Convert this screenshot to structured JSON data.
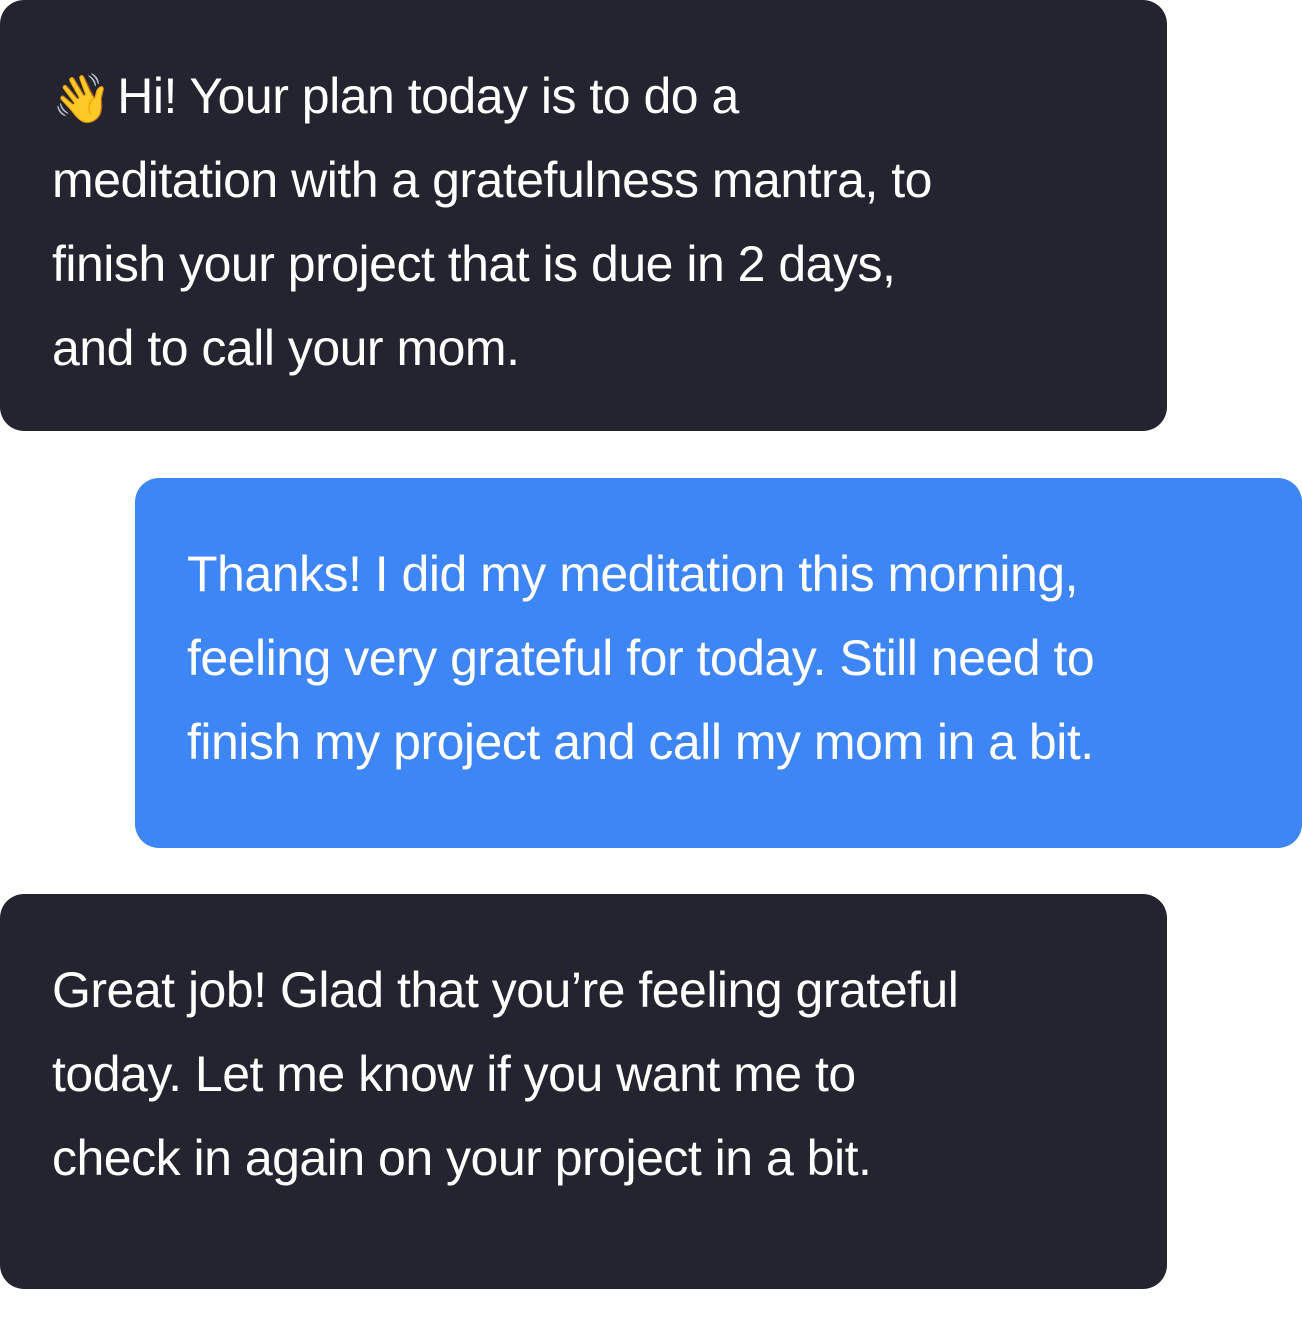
{
  "messages": [
    {
      "sender": "bot",
      "emoji": "👋",
      "text": "Hi! Your plan today is to do a\nmeditation with a gratefulness mantra, to\nfinish your project that is due in 2 days,\nand to call your mom."
    },
    {
      "sender": "user",
      "text": "Thanks! I did my meditation this morning,\nfeeling very grateful for today. Still need to\nfinish my project and call my mom in a bit."
    },
    {
      "sender": "bot",
      "text": "Great job! Glad that you’re feeling grateful\ntoday. Let me know if you want me to\ncheck in again on your project in a bit."
    }
  ],
  "colors": {
    "bot_bubble": "#23242f",
    "user_bubble": "#3e86f5",
    "text": "#ffffff",
    "background": "#ffffff"
  }
}
